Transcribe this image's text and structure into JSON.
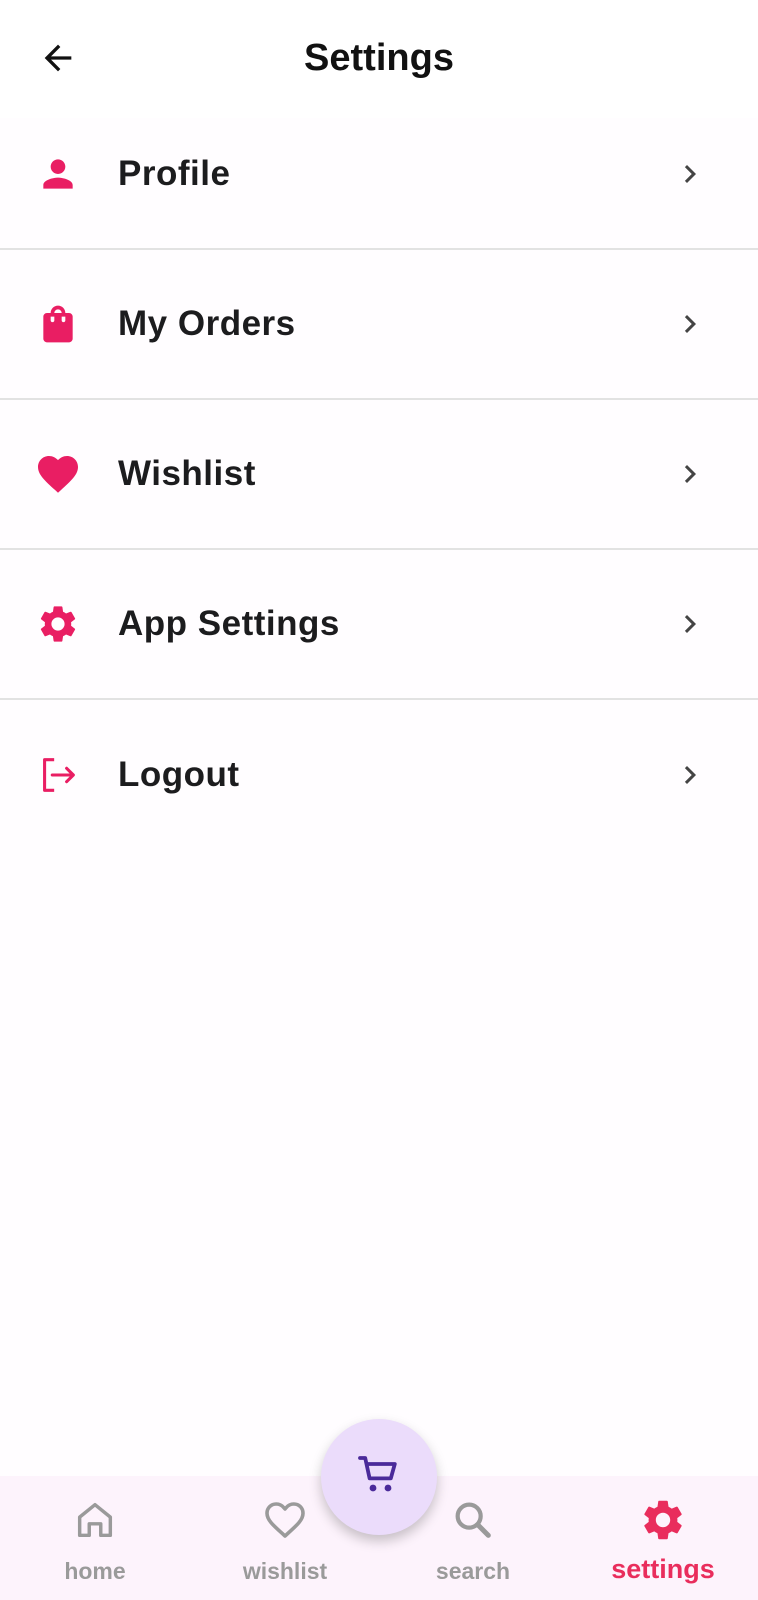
{
  "header": {
    "title": "Settings",
    "back_icon": "arrow-back-icon"
  },
  "menu": {
    "items": [
      {
        "label": "Profile",
        "icon": "person-icon"
      },
      {
        "label": "My Orders",
        "icon": "shopping-bag-icon"
      },
      {
        "label": "Wishlist",
        "icon": "heart-icon"
      },
      {
        "label": "App Settings",
        "icon": "gear-icon"
      },
      {
        "label": "Logout",
        "icon": "logout-icon"
      }
    ],
    "chevron_icon": "chevron-right-icon"
  },
  "bottom_nav": {
    "items": [
      {
        "label": "home",
        "icon": "home-icon",
        "active": false
      },
      {
        "label": "wishlist",
        "icon": "heart-outline-icon",
        "active": false
      },
      {
        "label": "search",
        "icon": "search-icon",
        "active": false
      },
      {
        "label": "settings",
        "icon": "gear-icon",
        "active": true
      }
    ],
    "fab_icon": "cart-icon"
  },
  "colors": {
    "accent": "#e91e63",
    "active_nav": "#e92d5c",
    "inactive_nav": "#9a9a9a",
    "fab_background": "#ebdcfb",
    "fab_icon": "#4a2a9a",
    "nav_background": "#fdf3fc"
  }
}
